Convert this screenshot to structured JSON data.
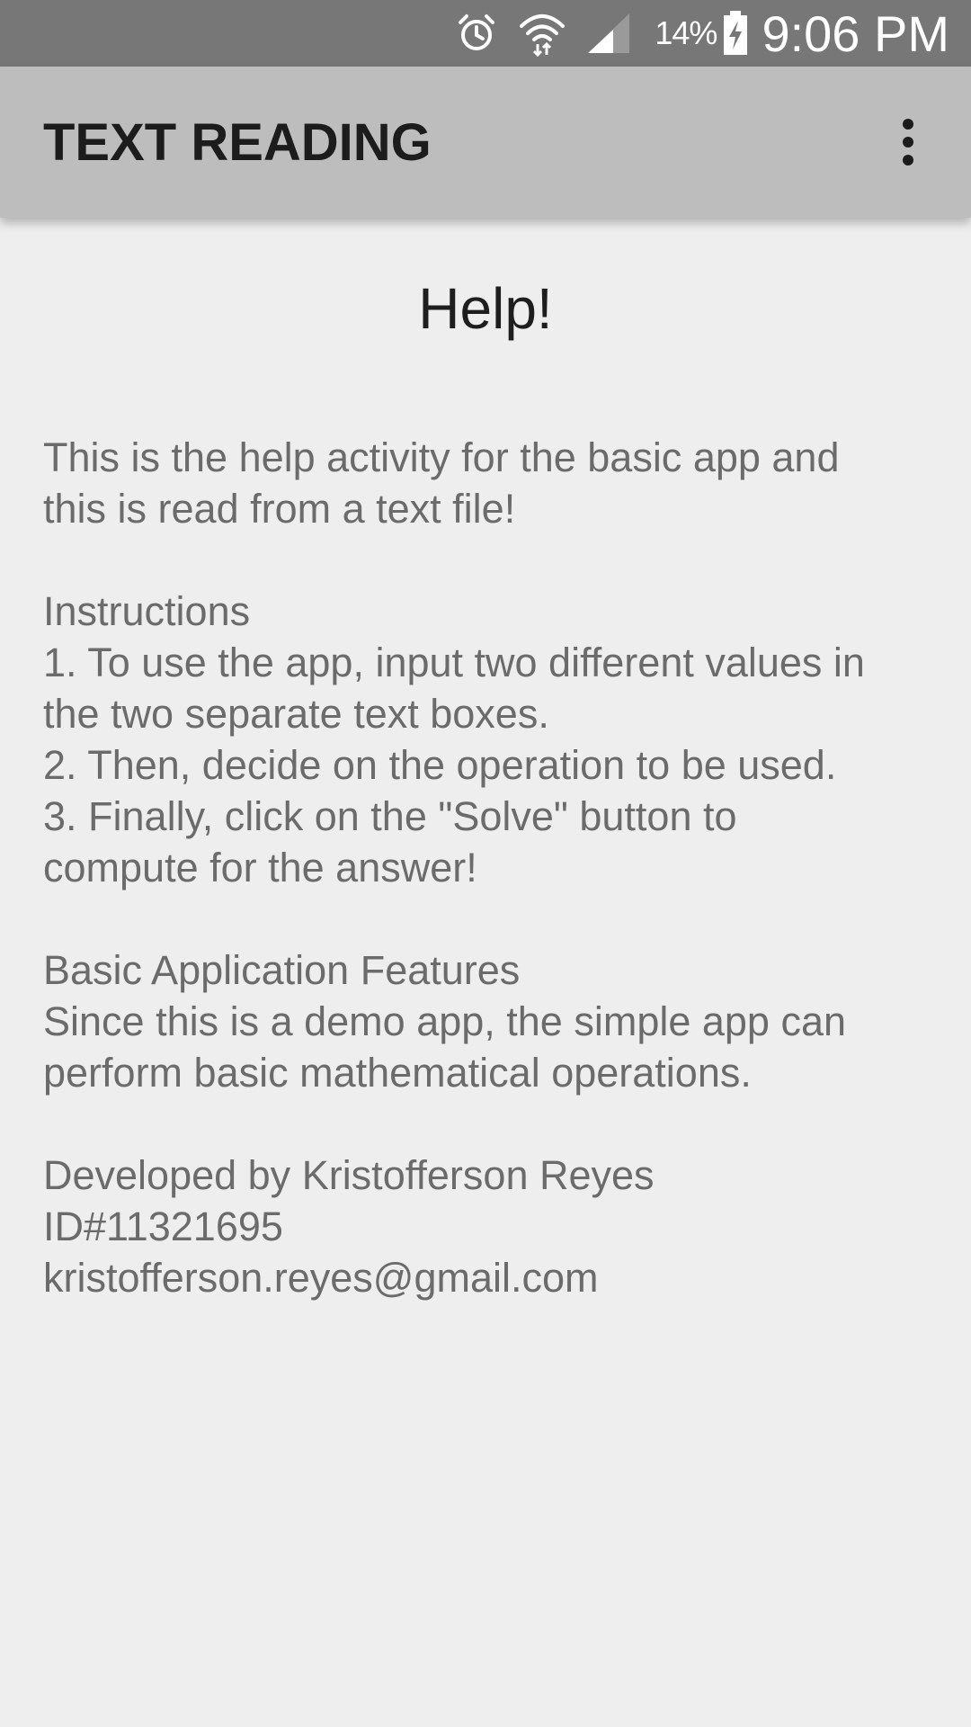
{
  "status_bar": {
    "alarm_icon": "alarm-clock-icon",
    "wifi_icon": "wifi-icon",
    "signal_icon": "cell-signal-icon",
    "battery_percent": "14%",
    "battery_icon": "battery-charging-icon",
    "time": "9:06 PM"
  },
  "app_bar": {
    "title": "TEXT READING",
    "overflow_icon": "more-vert-icon"
  },
  "help": {
    "title": "Help!",
    "intro_line_1": "This is the help activity for the basic app and",
    "intro_line_2": "this is read from a text file!",
    "instructions_heading": "Instructions",
    "step_1_line_1": "1.  To use the app, input two different values in",
    "step_1_line_2": "the two separate text boxes.",
    "step_2": "2.  Then, decide on the operation to be used.",
    "step_3_line_1": "3.  Finally, click on the \"Solve\" button to",
    "step_3_line_2": "compute for the answer!",
    "features_heading": "Basic Application Features",
    "features_line_1": "Since this is a demo app, the simple app can",
    "features_line_2": "perform basic mathematical operations.",
    "developer": "Developed by Kristofferson Reyes",
    "id": "ID#11321695",
    "email": "kristofferson.reyes@gmail.com"
  },
  "colors": {
    "status_bar_bg": "#777777",
    "app_bar_bg": "#bdbdbd",
    "page_bg": "#eeeeee",
    "title_text": "#1c1c1c",
    "body_text": "#6b6b6b"
  }
}
